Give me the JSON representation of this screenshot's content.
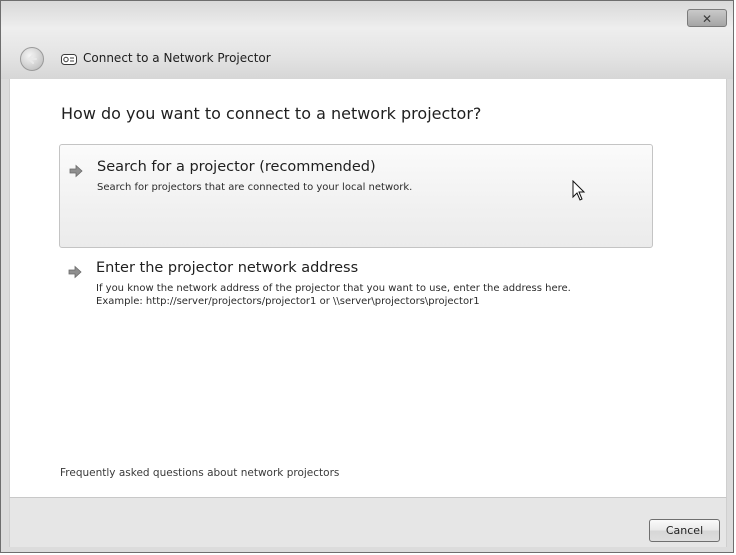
{
  "window": {
    "title": "Connect to a Network Projector",
    "close_label": "✕"
  },
  "main": {
    "heading": "How do you want to connect to a network projector?",
    "options": [
      {
        "title": "Search for a projector (recommended)",
        "description": [
          "Search for projectors that are connected to your local network."
        ]
      },
      {
        "title": "Enter the projector network address",
        "description": [
          "If you know the network address of the projector that you want to use, enter the address here.",
          "Example: http://server/projectors/projector1 or \\\\server\\projectors\\projector1"
        ]
      }
    ],
    "faq_link": "Frequently asked questions about network projectors"
  },
  "footer": {
    "cancel_label": "Cancel"
  },
  "icons": {
    "back": "back-arrow-icon",
    "app": "network-projector-icon",
    "option_arrow": "green-arrow-icon",
    "cursor": "mouse-pointer-icon"
  }
}
